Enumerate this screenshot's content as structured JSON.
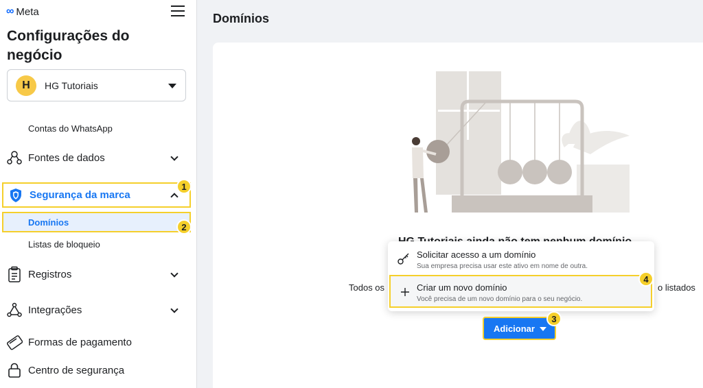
{
  "header": {
    "logo_text": "Meta",
    "business_title": "Configurações do negócio"
  },
  "account": {
    "avatar_letter": "H",
    "name": "HG Tutoriais"
  },
  "sidebar": {
    "items": [
      {
        "label": "Contas do WhatsApp",
        "icon": "none"
      },
      {
        "label": "Fontes de dados",
        "icon": "data-sources-icon"
      },
      {
        "label": "Segurança da marca",
        "icon": "shield-icon"
      },
      {
        "label": "Domínios",
        "icon": "none"
      },
      {
        "label": "Listas de bloqueio",
        "icon": "none"
      },
      {
        "label": "Registros",
        "icon": "clipboard-icon"
      },
      {
        "label": "Integrações",
        "icon": "integrations-icon"
      },
      {
        "label": "Formas de pagamento",
        "icon": "credit-card-icon"
      },
      {
        "label": "Centro de segurança",
        "icon": "lock-icon"
      }
    ]
  },
  "badges": [
    "1",
    "2",
    "3",
    "4"
  ],
  "main": {
    "page_title": "Domínios",
    "empty_heading": "HG Tutoriais ainda não tem nenhum domínio",
    "body_left": "Todos os",
    "body_right": "o listados"
  },
  "dropdown": {
    "items": [
      {
        "title": "Solicitar acesso a um domínio",
        "subtitle": "Sua empresa precisa usar este ativo em nome de outra.",
        "icon": "key-icon"
      },
      {
        "title": "Criar um novo domínio",
        "subtitle": "Você precisa de um novo domínio para o seu negócio.",
        "icon": "plus-icon"
      }
    ]
  },
  "add_button": {
    "label": "Adicionar"
  },
  "colors": {
    "accent": "#1877f2",
    "highlight": "#f5cf2a",
    "active_bg": "#e7f0fd"
  }
}
